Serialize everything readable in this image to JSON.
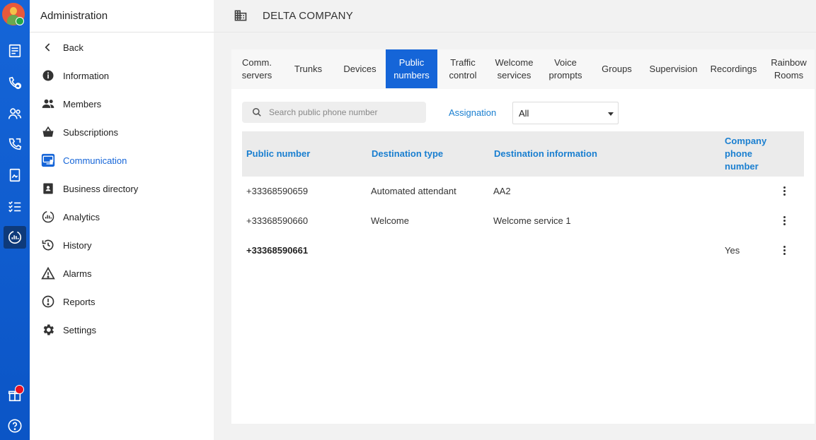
{
  "menu": {
    "title": "Administration",
    "items": [
      {
        "label": "Back",
        "icon": "chevron-left-icon"
      },
      {
        "label": "Information",
        "icon": "info-icon"
      },
      {
        "label": "Members",
        "icon": "members-icon"
      },
      {
        "label": "Subscriptions",
        "icon": "basket-icon"
      },
      {
        "label": "Communication",
        "icon": "communication-icon",
        "active": true
      },
      {
        "label": "Business directory",
        "icon": "directory-icon"
      },
      {
        "label": "Analytics",
        "icon": "analytics-icon"
      },
      {
        "label": "History",
        "icon": "history-icon"
      },
      {
        "label": "Alarms",
        "icon": "alarm-icon"
      },
      {
        "label": "Reports",
        "icon": "report-icon"
      },
      {
        "label": "Settings",
        "icon": "gear-icon"
      }
    ]
  },
  "header": {
    "company_name": "DELTA COMPANY",
    "icon": "building-icon"
  },
  "tabs": [
    {
      "label": "Comm.\nservers"
    },
    {
      "label": "Trunks"
    },
    {
      "label": "Devices"
    },
    {
      "label": "Public\nnumbers",
      "active": true
    },
    {
      "label": "Traffic\ncontrol"
    },
    {
      "label": "Welcome\nservices"
    },
    {
      "label": "Voice\nprompts"
    },
    {
      "label": "Groups"
    },
    {
      "label": "Supervision"
    },
    {
      "label": "Recordings"
    },
    {
      "label": "Rainbow\nRooms"
    }
  ],
  "search": {
    "placeholder": "Search public phone number",
    "value": ""
  },
  "filter": {
    "label": "Assignation",
    "selected": "All"
  },
  "table": {
    "columns": [
      "Public number",
      "Destination type",
      "Destination information",
      "Company phone number"
    ],
    "rows": [
      {
        "number": "+33368590659",
        "dest_type": "Automated attendant",
        "dest_info": "AA2",
        "company": ""
      },
      {
        "number": "+33368590660",
        "dest_type": "Welcome",
        "dest_info": "Welcome service 1",
        "company": ""
      },
      {
        "number": "+33368590661",
        "dest_type": "",
        "dest_info": "",
        "company": "Yes",
        "bold": true
      }
    ]
  },
  "colors": {
    "accent": "#1565d8",
    "link": "#1a7fd0",
    "rail": "#1565d8",
    "notification": "#e81123"
  }
}
